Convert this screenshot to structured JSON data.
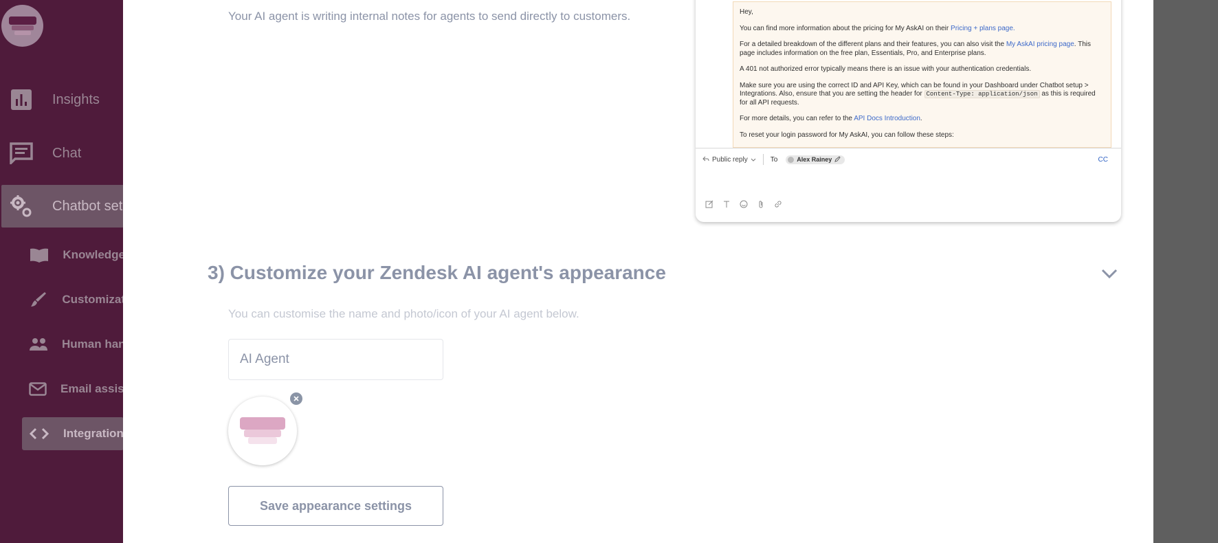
{
  "sidebar": {
    "items": [
      {
        "label": "Insights",
        "icon": "bar-chart-icon"
      },
      {
        "label": "Chat",
        "icon": "chat-icon"
      },
      {
        "label": "Chatbot set",
        "icon": "gears-icon"
      }
    ],
    "sub_items": [
      {
        "label": "Knowledge",
        "icon": "book-icon"
      },
      {
        "label": "Customizat",
        "icon": "brush-icon"
      },
      {
        "label": "Human han",
        "icon": "people-icon"
      },
      {
        "label": "Email assist",
        "icon": "mail-icon"
      },
      {
        "label": "Integration",
        "icon": "code-icon"
      }
    ]
  },
  "intro_text": "Your AI agent is writing internal notes for agents to  send directly to customers.",
  "email_preview": {
    "greeting": "Hey,",
    "p1_pre": "You can find more information about the pricing for My AskAI on their ",
    "p1_link": "Pricing + plans page.",
    "p2_pre": "For a detailed breakdown of the different plans and their features, you can also visit the ",
    "p2_link": "My AskAI pricing page",
    "p2_post": ". This page includes information on the free plan, Essentials, Pro, and Enterprise plans.",
    "p3": "A 401 not authorized error typically means there is an issue with your authentication credentials.",
    "p4_pre": "Make sure you are using the correct ID and API Key, which can be found in your Dashboard under Chatbot setup > Integrations. Also, ensure that you are setting the header for ",
    "p4_code": "Content-Type: application/json",
    "p4_post": " as this is required for all API requests.",
    "p5_pre": "For more details, you can refer to the ",
    "p5_link": "API Docs Introduction",
    "p5_post": ".",
    "p6": "To reset your login password for My AskAI, you can follow these steps:",
    "reply_type": "Public reply",
    "to_label": "To",
    "recipient": "Alex Rainey",
    "cc_label": "CC"
  },
  "section3": {
    "title": "3) Customize your Zendesk AI agent's appearance",
    "subtitle": "You can customise the name and photo/icon of your AI agent below.",
    "name_value": "AI Agent",
    "save_label": "Save appearance settings"
  },
  "colors": {
    "sidebar_bg": "#4f1b3b",
    "muted_text": "#8b93a7",
    "link": "#3d69c9"
  }
}
